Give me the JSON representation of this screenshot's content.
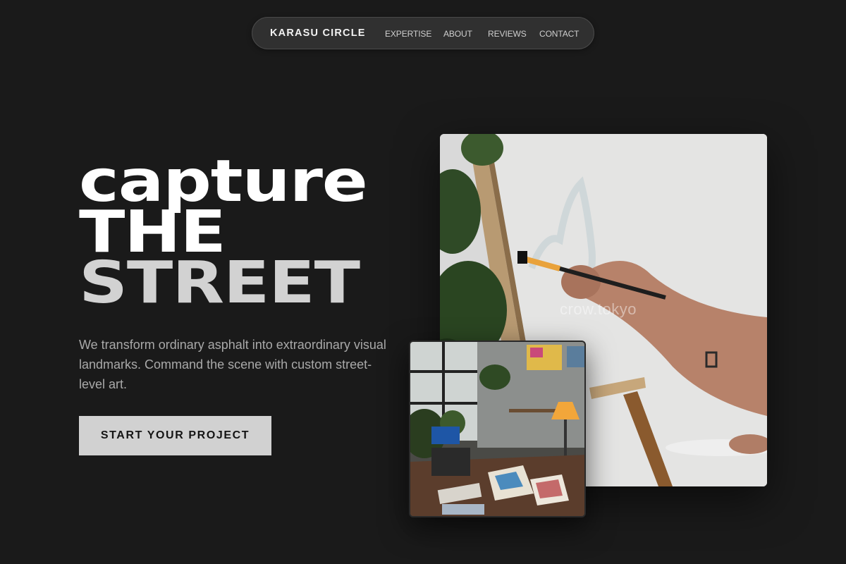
{
  "nav": {
    "brand": "KARASU CIRCLE",
    "links": [
      "EXPERTISE",
      "ABOUT",
      "REVIEWS",
      "CONTACT"
    ]
  },
  "hero": {
    "headline": [
      "capture",
      "THE",
      "STREET"
    ],
    "lead": "We transform ordinary asphalt into extraordinary visual landmarks. Command the scene with custom street-level art.",
    "cta": "START YOUR PROJECT"
  },
  "images": {
    "main_watermark": "crow.tokyo",
    "main_icon": "painting-on-canvas-photo",
    "second_icon": "art-studio-workspace-photo"
  },
  "colors": {
    "background": "#1a1a1a",
    "nav_background": "#303030",
    "cta_background": "#d1d1d1",
    "lead_text": "#a9a9a9",
    "headline_muted": "#d2d2d2"
  }
}
